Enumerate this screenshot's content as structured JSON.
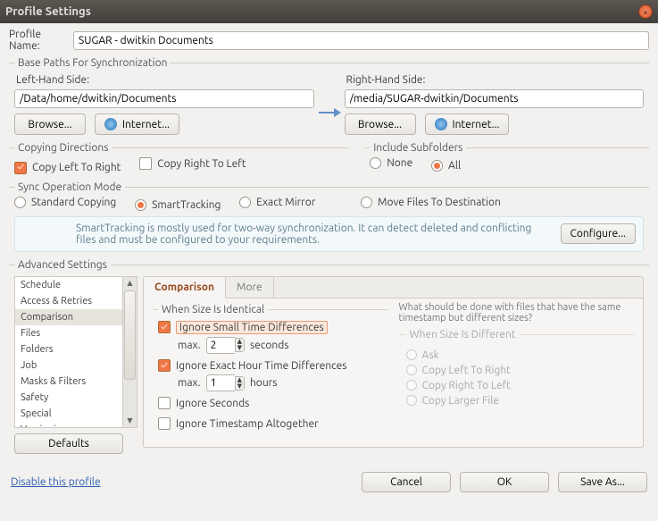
{
  "window": {
    "title": "Profile Settings"
  },
  "profile": {
    "name_label": "Profile Name:",
    "name_value": "SUGAR - dwitkin Documents"
  },
  "basepaths": {
    "legend": "Base Paths For Synchronization",
    "left_label": "Left-Hand Side:",
    "left_value": "/Data/home/dwitkin/Documents",
    "right_label": "Right-Hand Side:",
    "right_value": "/media/SUGAR-dwitkin/Documents",
    "browse": "Browse...",
    "internet": "Internet..."
  },
  "copydir": {
    "legend": "Copying Directions",
    "ltr": "Copy Left To Right",
    "rtl": "Copy Right To Left",
    "ltr_checked": true,
    "rtl_checked": false
  },
  "subfolders": {
    "legend": "Include Subfolders",
    "none": "None",
    "all": "All"
  },
  "syncmode": {
    "legend": "Sync Operation Mode",
    "standard": "Standard Copying",
    "smart": "SmartTracking",
    "exact": "Exact Mirror",
    "move": "Move Files To Destination",
    "info": "SmartTracking is mostly used for two-way synchronization. It can detect deleted and conflicting files and must be configured to your requirements.",
    "configure": "Configure..."
  },
  "advanced": {
    "legend": "Advanced Settings",
    "categories": [
      "Schedule",
      "Access & Retries",
      "Comparison",
      "Files",
      "Folders",
      "Job",
      "Masks & Filters",
      "Safety",
      "Special",
      "Versioning"
    ],
    "defaults": "Defaults",
    "tabs": {
      "comparison": "Comparison",
      "more": "More"
    },
    "identical": {
      "legend": "When Size Is Identical",
      "ignore_small": "Ignore Small Time Differences",
      "max": "max.",
      "seconds_val": "2",
      "seconds_unit": "seconds",
      "ignore_hour": "Ignore Exact Hour Time Differences",
      "hours_val": "1",
      "hours_unit": "hours",
      "ignore_seconds": "Ignore Seconds",
      "ignore_ts": "Ignore Timestamp Altogether"
    },
    "different": {
      "question": "What should be done with files that have the same timestamp but different sizes?",
      "legend": "When Size Is Different",
      "ask": "Ask",
      "cl": "Copy Left To Right",
      "cr": "Copy Right To Left",
      "larger": "Copy Larger File"
    }
  },
  "footer": {
    "disable": "Disable this profile",
    "cancel": "Cancel",
    "ok": "OK",
    "saveas": "Save As..."
  }
}
